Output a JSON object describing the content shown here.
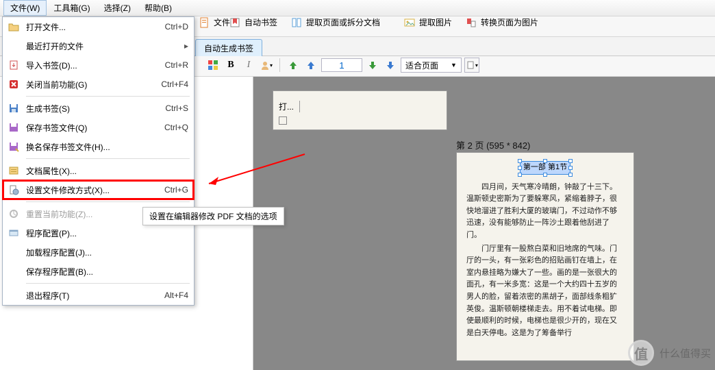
{
  "menubar": {
    "file": "文件(W)",
    "toolbox": "工具箱(G)",
    "select": "选择(Z)",
    "help": "帮助(B)"
  },
  "toolbar": {
    "doc": "文件",
    "autobookmark": "自动书签",
    "split": "提取页面或拆分文档",
    "extractimg": "提取图片",
    "toimg": "转换页面为图片"
  },
  "tab": {
    "autobm": "自动生成书签"
  },
  "toolbar2": {
    "bold": "B",
    "italic": "I",
    "page": "1",
    "zoom": "适合页面"
  },
  "dropdown": {
    "open": {
      "label": "打开文件...",
      "shortcut": "Ctrl+D"
    },
    "recent": {
      "label": "最近打开的文件"
    },
    "importbm": {
      "label": "导入书签(D)...",
      "shortcut": "Ctrl+R"
    },
    "closefn": {
      "label": "关闭当前功能(G)",
      "shortcut": "Ctrl+F4"
    },
    "genbm": {
      "label": "生成书签(S)",
      "shortcut": "Ctrl+S"
    },
    "savebm": {
      "label": "保存书签文件(Q)",
      "shortcut": "Ctrl+Q"
    },
    "saveas": {
      "label": "换名保存书签文件(H)..."
    },
    "docprop": {
      "label": "文档属性(X)..."
    },
    "setmod": {
      "label": "设置文件修改方式(X)...",
      "shortcut": "Ctrl+G"
    },
    "resetfn": {
      "label": "重置当前功能(Z)..."
    },
    "progcfg": {
      "label": "程序配置(P)..."
    },
    "loadcfg": {
      "label": "加载程序配置(J)..."
    },
    "savecfg": {
      "label": "保存程序配置(B)..."
    },
    "exit": {
      "label": "退出程序(T)",
      "shortcut": "Alt+F4"
    }
  },
  "tooltip": {
    "text": "设置在编辑器修改 PDF 文档的选项"
  },
  "pages": {
    "p1_cell": "打...",
    "p2_label": "第 2 页 (595 * 842)",
    "p2_highlight": "第一部 第1节",
    "p2_para1": "四月间，天气寒冷晴朗，钟敲了十三下。温斯顿史密斯为了要躲寒风，紧缩着脖子，很快地溜进了胜利大厦的玻璃门，不过动作不够迅速，没有能够防止一阵沙土跟着他刮进了门。",
    "p2_para2": "门厅里有一股熬白菜和旧地席的气味。门厅的一头，有一张彩色的招贴画钉在墙上，在室内悬挂略为嫌大了一些。画的是一张很大的面孔，有一米多宽：这是一个大约四十五岁的男人的脸，留着浓密的黑胡子，面部线条粗犷英俊。温斯顿朝楼梯走去。用不着试电梯。即使最顺利的时候，电梯也是很少开的，现在又是白天停电。这是为了筹备举行"
  },
  "watermark": {
    "text": "什么值得买"
  }
}
